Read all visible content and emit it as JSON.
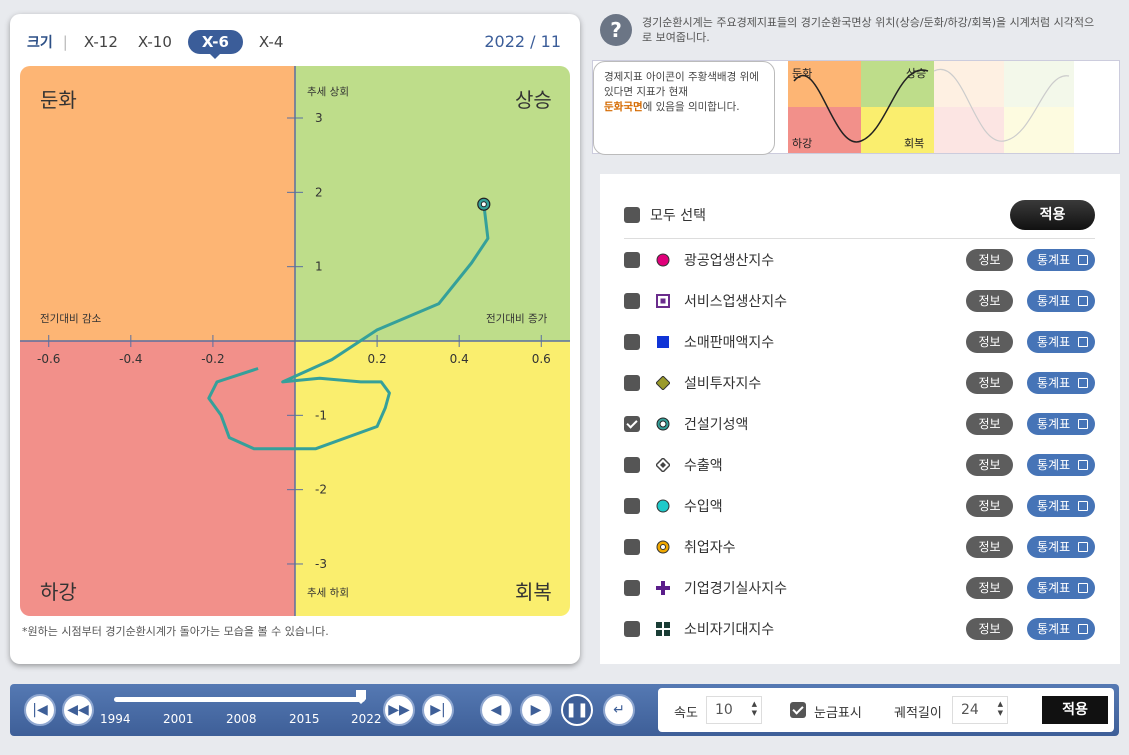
{
  "zoom": {
    "label": "크기",
    "options": [
      "X-12",
      "X-10",
      "X-6",
      "X-4"
    ],
    "active": "X-6"
  },
  "date": "2022 / 11",
  "quadrants": {
    "slowdown": "둔화",
    "rise": "상승",
    "fall": "하강",
    "recovery": "회복"
  },
  "axis_labels": {
    "trend_up": "추세 상회",
    "trend_down": "추세 하회",
    "mom_decrease": "전기대비 감소",
    "mom_increase": "전기대비 증가"
  },
  "colors": {
    "slowdown": "#fdb574",
    "rise": "#bedd8a",
    "fall": "#f2908a",
    "recovery": "#faee6e",
    "path": "#35a09a",
    "axis": "#5a6fa0"
  },
  "chart_data": {
    "type": "line",
    "xlim": [
      -0.67,
      0.67
    ],
    "ylim": [
      -3.7,
      3.7
    ],
    "x_ticks": [
      -0.6,
      -0.4,
      -0.2,
      0.2,
      0.4,
      0.6
    ],
    "y_ticks": [
      3,
      2,
      1,
      -1,
      -2,
      -3
    ],
    "series": [
      {
        "x": [
          -0.09,
          -0.19,
          -0.21,
          -0.18,
          -0.16,
          -0.1,
          0.05,
          0.2,
          0.22,
          0.23,
          0.21,
          0.16,
          0.06,
          -0.03,
          0.09,
          0.2,
          0.35,
          0.43,
          0.47,
          0.46
        ],
        "y": [
          -0.37,
          -0.55,
          -0.77,
          -1.0,
          -1.3,
          -1.45,
          -1.45,
          -1.15,
          -0.9,
          -0.7,
          -0.55,
          -0.55,
          -0.5,
          -0.55,
          -0.25,
          0.15,
          0.5,
          1.05,
          1.38,
          1.84
        ]
      }
    ]
  },
  "footnote": "*원하는 시점부터 경기순환시계가 돌아가는 모습을 볼 수 있습니다.",
  "help": {
    "text": "경기순환시계는 주요경제지표들의 경기순환국면상 위치(상승/둔화/하강/회복)을 시계처럼 시각적으로 보여줍니다.",
    "icon": "question-icon"
  },
  "legend": {
    "bubble_line1": "경제지표 아이콘이 주황색배경 위에 있다면 지표가 현재",
    "bubble_emph": "둔화국면",
    "bubble_line2": "에 있음을 의미합니다.",
    "mini": {
      "slowdown": "둔화",
      "rise": "상승",
      "fall": "하강",
      "recovery": "회복"
    }
  },
  "indicators": {
    "select_all": "모두 선택",
    "apply": "적용",
    "info": "정보",
    "stats": "통계표",
    "items": [
      {
        "name": "광공업생산지수",
        "checked": false,
        "icon": "magenta-circle"
      },
      {
        "name": "서비스업생산지수",
        "checked": false,
        "icon": "purple-square-outline"
      },
      {
        "name": "소매판매액지수",
        "checked": false,
        "icon": "blue-square"
      },
      {
        "name": "설비투자지수",
        "checked": false,
        "icon": "olive-diamond"
      },
      {
        "name": "건설기성액",
        "checked": true,
        "icon": "teal-ring"
      },
      {
        "name": "수출액",
        "checked": false,
        "icon": "gray-diamond-outline"
      },
      {
        "name": "수입액",
        "checked": false,
        "icon": "cyan-circle"
      },
      {
        "name": "취업자수",
        "checked": false,
        "icon": "orange-ring"
      },
      {
        "name": "기업경기실사지수",
        "checked": false,
        "icon": "purple-cross"
      },
      {
        "name": "소비자기대지수",
        "checked": false,
        "icon": "green-grid"
      }
    ]
  },
  "player": {
    "years": [
      "1994",
      "2001",
      "2008",
      "2015",
      "2022"
    ],
    "progress": 0.97,
    "speed_label": "속도",
    "speed": "10",
    "grid_label": "눈금표시",
    "grid_checked": true,
    "trail_label": "궤적길이",
    "trail": "24",
    "apply": "적용"
  }
}
